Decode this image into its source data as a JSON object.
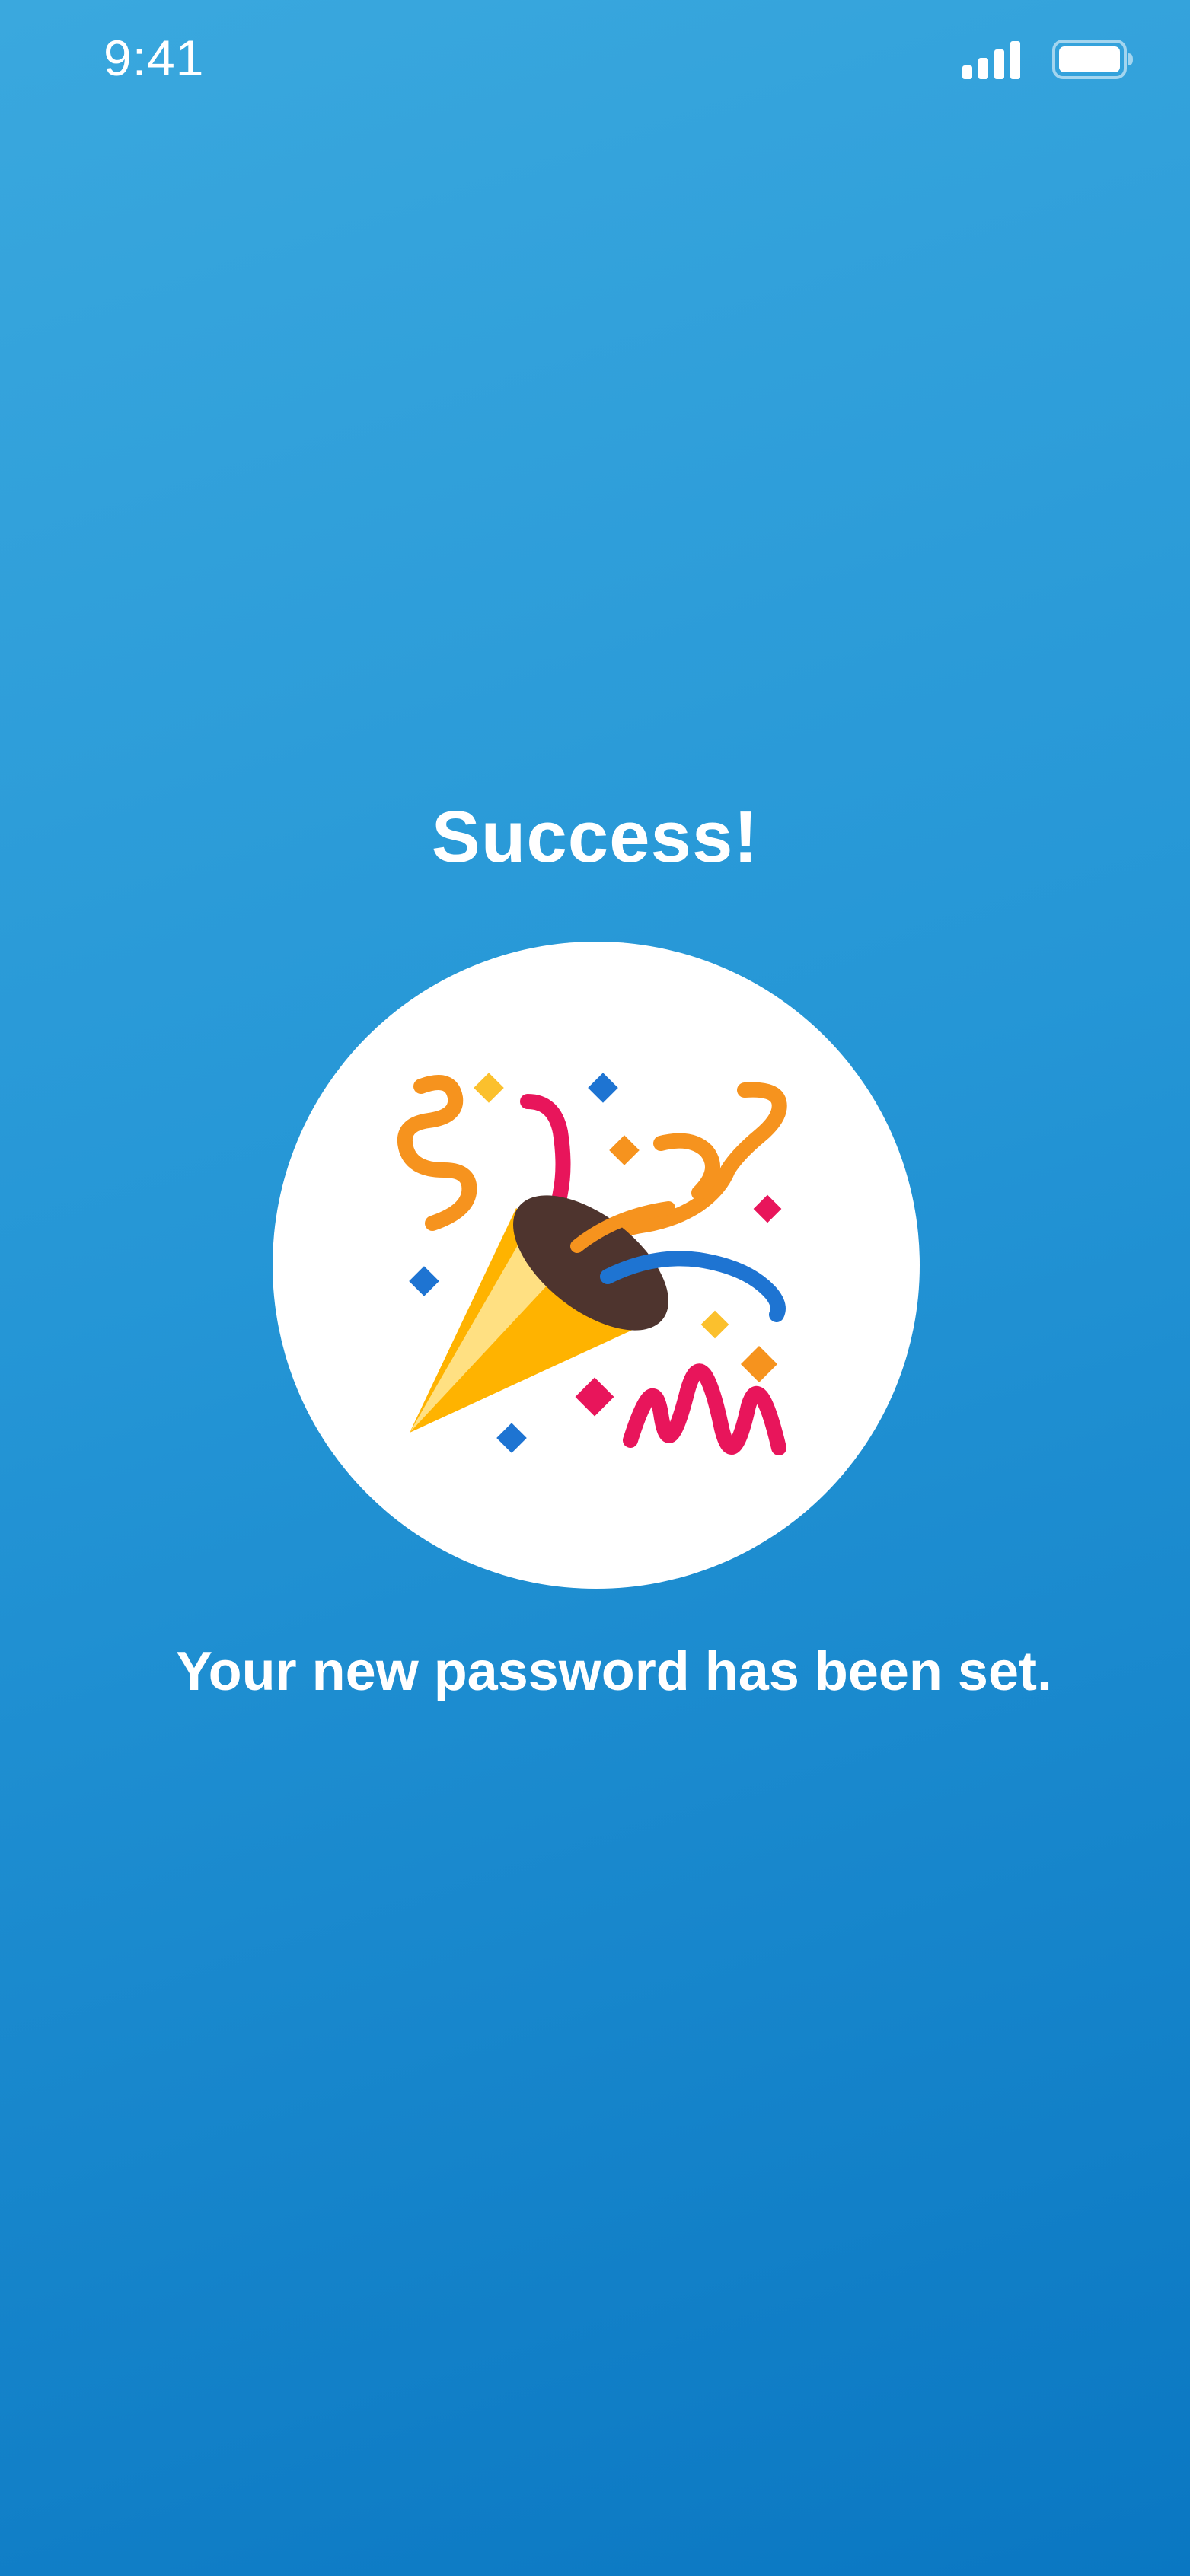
{
  "status_bar": {
    "time": "9:41",
    "signal_icon": "cellular-signal-icon",
    "battery_icon": "battery-icon"
  },
  "screen": {
    "title": "Success!",
    "illustration_icon": "party-popper-icon",
    "message": "Your new password has been set."
  },
  "colors": {
    "background_top": "#3aa8de",
    "background_bottom": "#0a77c2",
    "text": "#ffffff",
    "circle": "#ffffff"
  }
}
